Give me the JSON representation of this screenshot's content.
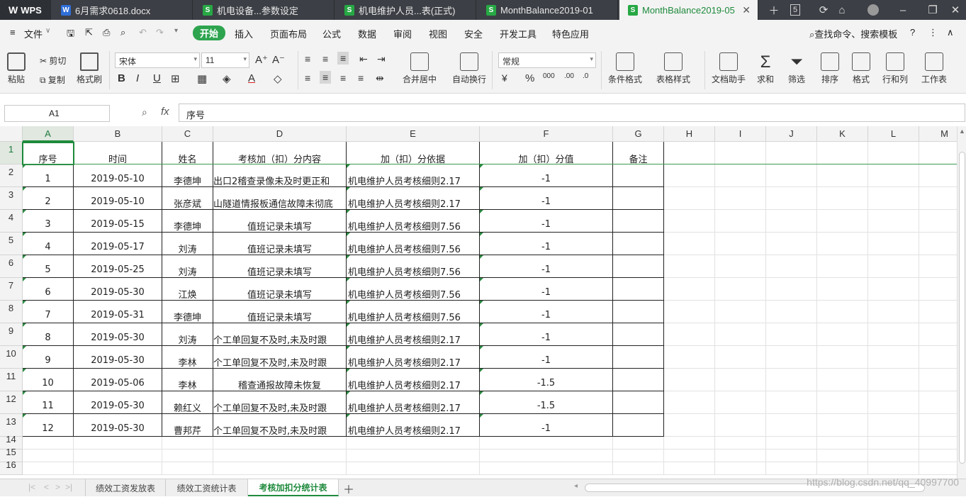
{
  "app": {
    "title": "WPS"
  },
  "tabs": [
    {
      "label": "6月需求0618.docx",
      "type": "W"
    },
    {
      "label": "机电设备...参数设定",
      "type": "S"
    },
    {
      "label": "机电维护人员...表(正式)",
      "type": "S"
    },
    {
      "label": "MonthBalance2019-01",
      "type": "S"
    },
    {
      "label": "MonthBalance2019-05",
      "type": "S",
      "active": true
    }
  ],
  "tab_count": "5",
  "menu": {
    "file": "文件",
    "items": [
      "开始",
      "插入",
      "页面布局",
      "公式",
      "数据",
      "审阅",
      "视图",
      "安全",
      "开发工具",
      "特色应用"
    ],
    "search": "查找命令、搜索模板"
  },
  "ribbon": {
    "paste": "粘贴",
    "cut": "剪切",
    "copy": "复制",
    "format_painter": "格式刷",
    "font_name": "宋体",
    "font_size": "11",
    "merge": "合并居中",
    "wrap": "自动换行",
    "number_format": "常规",
    "cond_format": "条件格式",
    "table_style": "表格样式",
    "doc_helper": "文档助手",
    "sum": "求和",
    "filter": "筛选",
    "sort": "排序",
    "format": "格式",
    "rowcol": "行和列",
    "worksheet": "工作表"
  },
  "formula_bar": {
    "name_box": "A1",
    "fx": "fx",
    "content": "序号"
  },
  "columns": [
    "A",
    "B",
    "C",
    "D",
    "E",
    "F",
    "G",
    "H",
    "I",
    "J",
    "K",
    "L",
    "M"
  ],
  "rows": [
    "1",
    "2",
    "3",
    "4",
    "5",
    "6",
    "7",
    "8",
    "9",
    "10",
    "11",
    "12",
    "13",
    "14",
    "15",
    "16"
  ],
  "table": {
    "headers": [
      "序号",
      "时间",
      "姓名",
      "考核加（扣）分内容",
      "加（扣）分依据",
      "加（扣）分值",
      "备注"
    ],
    "rows": [
      [
        "1",
        "2019-05-10",
        "李德坤",
        "出口2稽查录像未及时更正和",
        "机电维护人员考核细则2.17",
        "-1",
        ""
      ],
      [
        "2",
        "2019-05-10",
        "张彦斌",
        "山隧道情报板通信故障未彻底",
        "机电维护人员考核细则2.17",
        "-1",
        ""
      ],
      [
        "3",
        "2019-05-15",
        "李德坤",
        "值班记录未填写",
        "机电维护人员考核细则7.56",
        "-1",
        ""
      ],
      [
        "4",
        "2019-05-17",
        "刘涛",
        "值班记录未填写",
        "机电维护人员考核细则7.56",
        "-1",
        ""
      ],
      [
        "5",
        "2019-05-25",
        "刘涛",
        "值班记录未填写",
        "机电维护人员考核细则7.56",
        "-1",
        ""
      ],
      [
        "6",
        "2019-05-30",
        "江焕",
        "值班记录未填写",
        "机电维护人员考核细则7.56",
        "-1",
        ""
      ],
      [
        "7",
        "2019-05-31",
        "李德坤",
        "值班记录未填写",
        "机电维护人员考核细则7.56",
        "-1",
        ""
      ],
      [
        "8",
        "2019-05-30",
        "刘涛",
        "个工单回复不及时,未及时跟",
        "机电维护人员考核细则2.17",
        "-1",
        ""
      ],
      [
        "9",
        "2019-05-30",
        "李林",
        "个工单回复不及时,未及时跟",
        "机电维护人员考核细则2.17",
        "-1",
        ""
      ],
      [
        "10",
        "2019-05-06",
        "李林",
        "稽查通报故障未恢复",
        "机电维护人员考核细则2.17",
        "-1.5",
        ""
      ],
      [
        "11",
        "2019-05-30",
        "赖红义",
        "个工单回复不及时,未及时跟",
        "机电维护人员考核细则2.17",
        "-1.5",
        ""
      ],
      [
        "12",
        "2019-05-30",
        "曹邦芹",
        "个工单回复不及时,未及时跟",
        "机电维护人员考核细则2.17",
        "-1",
        ""
      ]
    ]
  },
  "sheets": [
    "绩效工资发放表",
    "绩效工资统计表",
    "考核加扣分统计表"
  ],
  "active_sheet": "考核加扣分统计表",
  "watermark": "https://blog.csdn.net/qq_40997700"
}
